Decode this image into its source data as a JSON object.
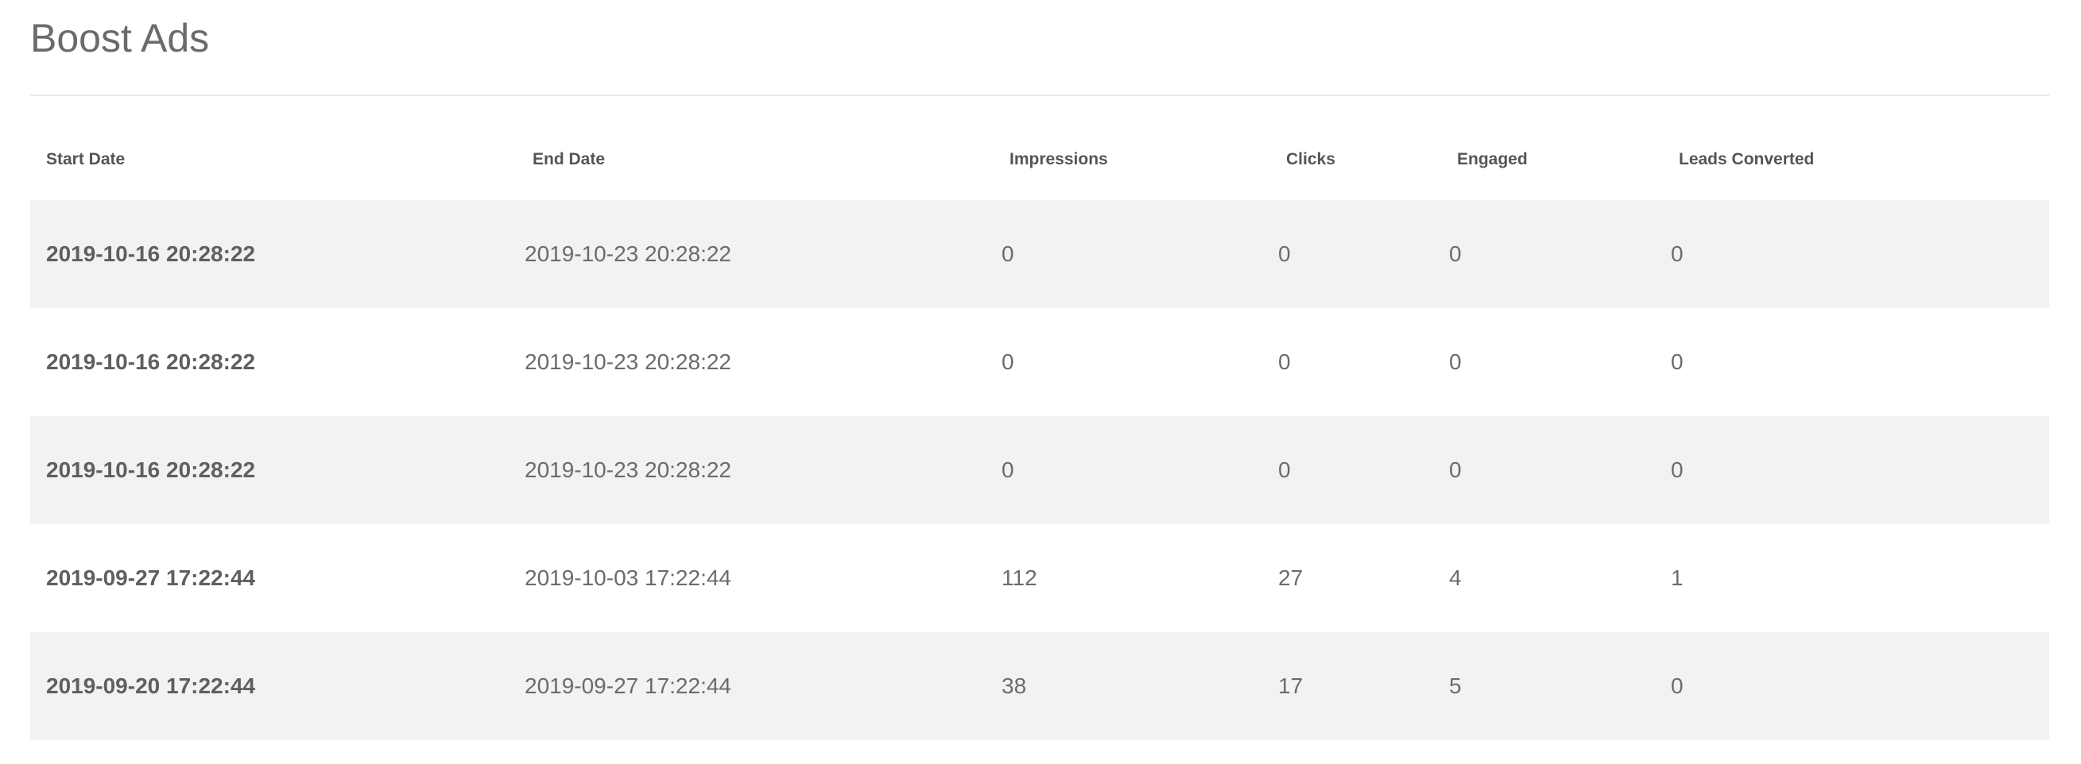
{
  "page": {
    "title": "Boost Ads"
  },
  "table": {
    "headers": {
      "start_date": "Start Date",
      "end_date": "End Date",
      "impressions": "Impressions",
      "clicks": "Clicks",
      "engaged": "Engaged",
      "leads_converted": "Leads Converted"
    },
    "rows": [
      {
        "start_date": "2019-10-16 20:28:22",
        "end_date": "2019-10-23 20:28:22",
        "impressions": "0",
        "clicks": "0",
        "engaged": "0",
        "leads_converted": "0"
      },
      {
        "start_date": "2019-10-16 20:28:22",
        "end_date": "2019-10-23 20:28:22",
        "impressions": "0",
        "clicks": "0",
        "engaged": "0",
        "leads_converted": "0"
      },
      {
        "start_date": "2019-10-16 20:28:22",
        "end_date": "2019-10-23 20:28:22",
        "impressions": "0",
        "clicks": "0",
        "engaged": "0",
        "leads_converted": "0"
      },
      {
        "start_date": "2019-09-27 17:22:44",
        "end_date": "2019-10-03 17:22:44",
        "impressions": "112",
        "clicks": "27",
        "engaged": "4",
        "leads_converted": "1"
      },
      {
        "start_date": "2019-09-20 17:22:44",
        "end_date": "2019-09-27 17:22:44",
        "impressions": "38",
        "clicks": "17",
        "engaged": "5",
        "leads_converted": "0"
      }
    ]
  },
  "colors": {
    "text": "#6b6b6b",
    "header_text": "#555555",
    "row_stripe": "#f1f2f4",
    "divider": "#ebebeb"
  }
}
